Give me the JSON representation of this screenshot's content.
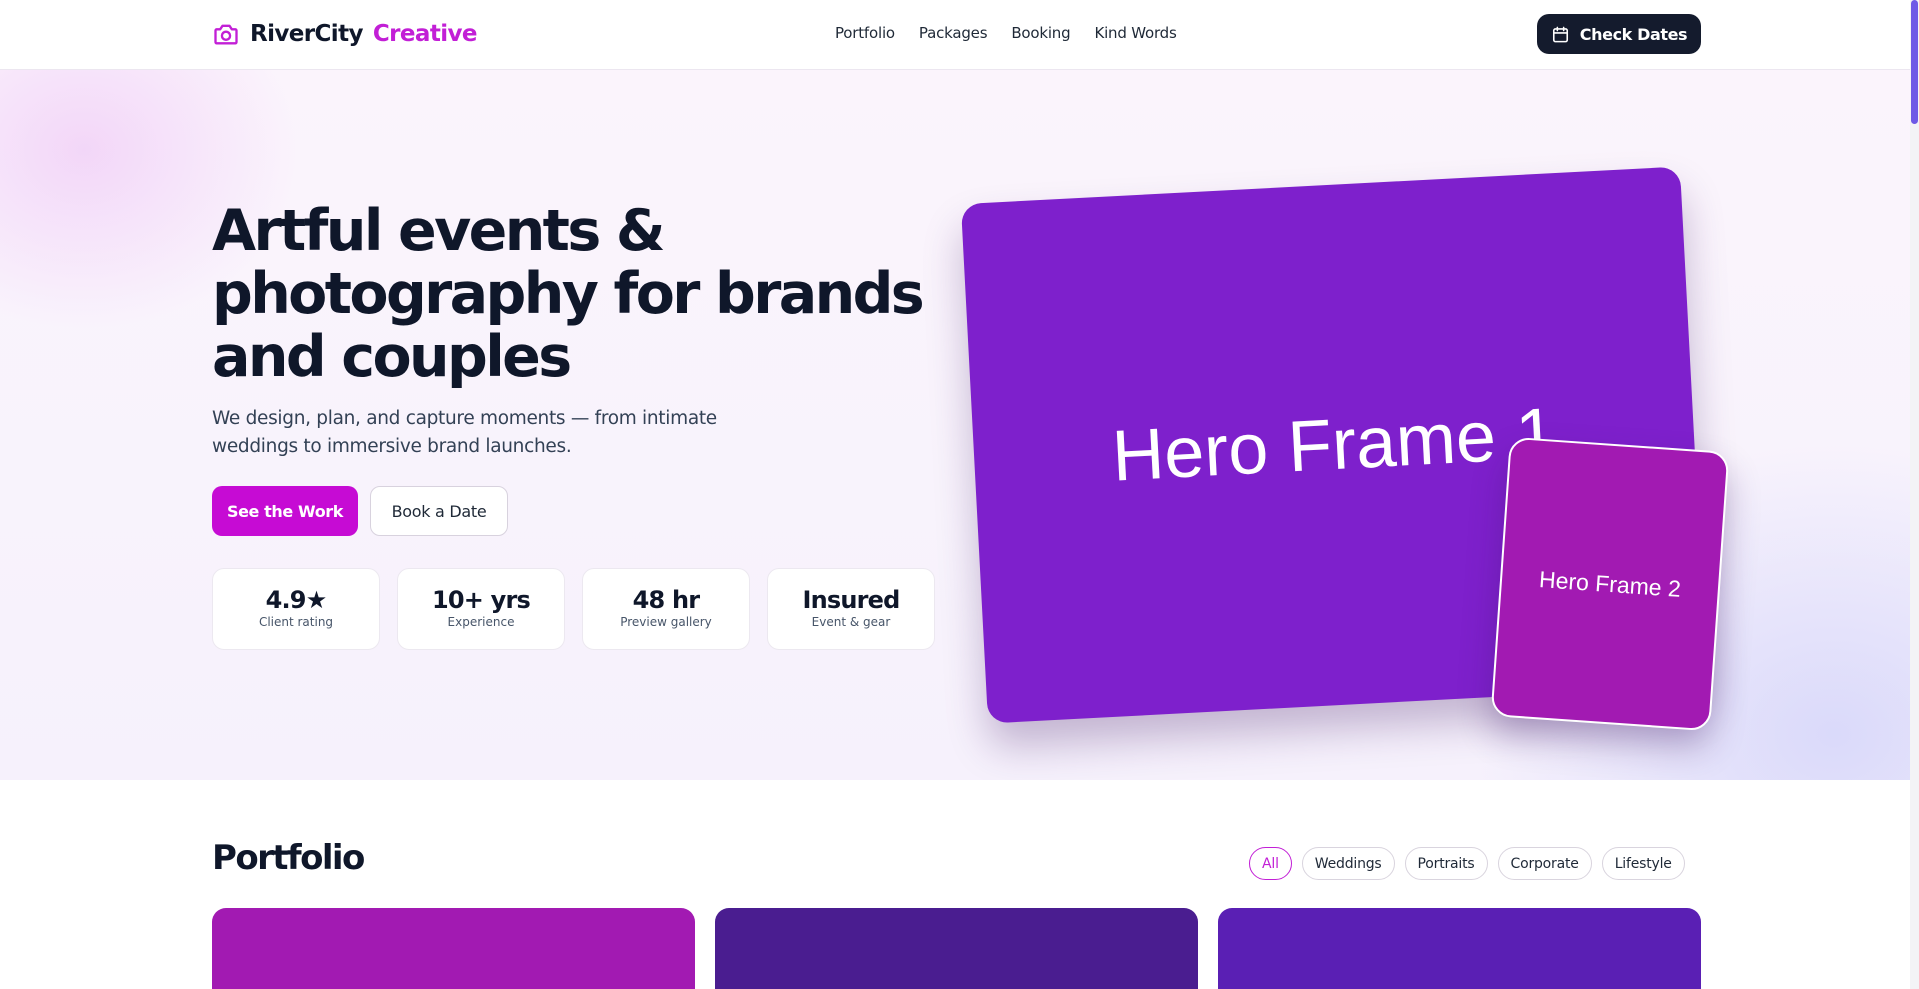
{
  "header": {
    "brand_part1": "RiverCity",
    "brand_part2": "Creative",
    "brand_icon": "camera-icon",
    "nav": [
      "Portfolio",
      "Packages",
      "Booking",
      "Kind Words"
    ],
    "cta_label": "Check Dates",
    "cta_icon": "calendar-icon"
  },
  "hero": {
    "title_line1": "Artful events &",
    "title_line2": "photography for brands",
    "title_line3": "and couples",
    "subtitle_line1": "We design, plan, and capture moments — from intimate",
    "subtitle_line2": "weddings to immersive brand launches.",
    "primary_label": "See the Work",
    "secondary_label": "Book a Date",
    "stats": [
      {
        "value": "4.9★",
        "label": "Client rating"
      },
      {
        "value": "10+ yrs",
        "label": "Experience"
      },
      {
        "value": "48 hr",
        "label": "Preview gallery"
      },
      {
        "value": "Insured",
        "label": "Event & gear"
      }
    ],
    "frame1_label": "Hero Frame 1",
    "frame2_label": "Hero Frame 2"
  },
  "portfolio": {
    "title": "Portfolio",
    "filters": [
      "All",
      "Weddings",
      "Portraits",
      "Corporate",
      "Lifestyle"
    ],
    "active_filter": "All"
  },
  "colors": {
    "brand_accent": "#c21fd6",
    "primary_button": "#c60bd4",
    "dark_button": "#141b2d",
    "frame1": "#7e20cc",
    "frame2": "#a21ab2",
    "card1": "#a21ab2",
    "card2": "#4a1d90",
    "card3": "#5a1fb4"
  }
}
